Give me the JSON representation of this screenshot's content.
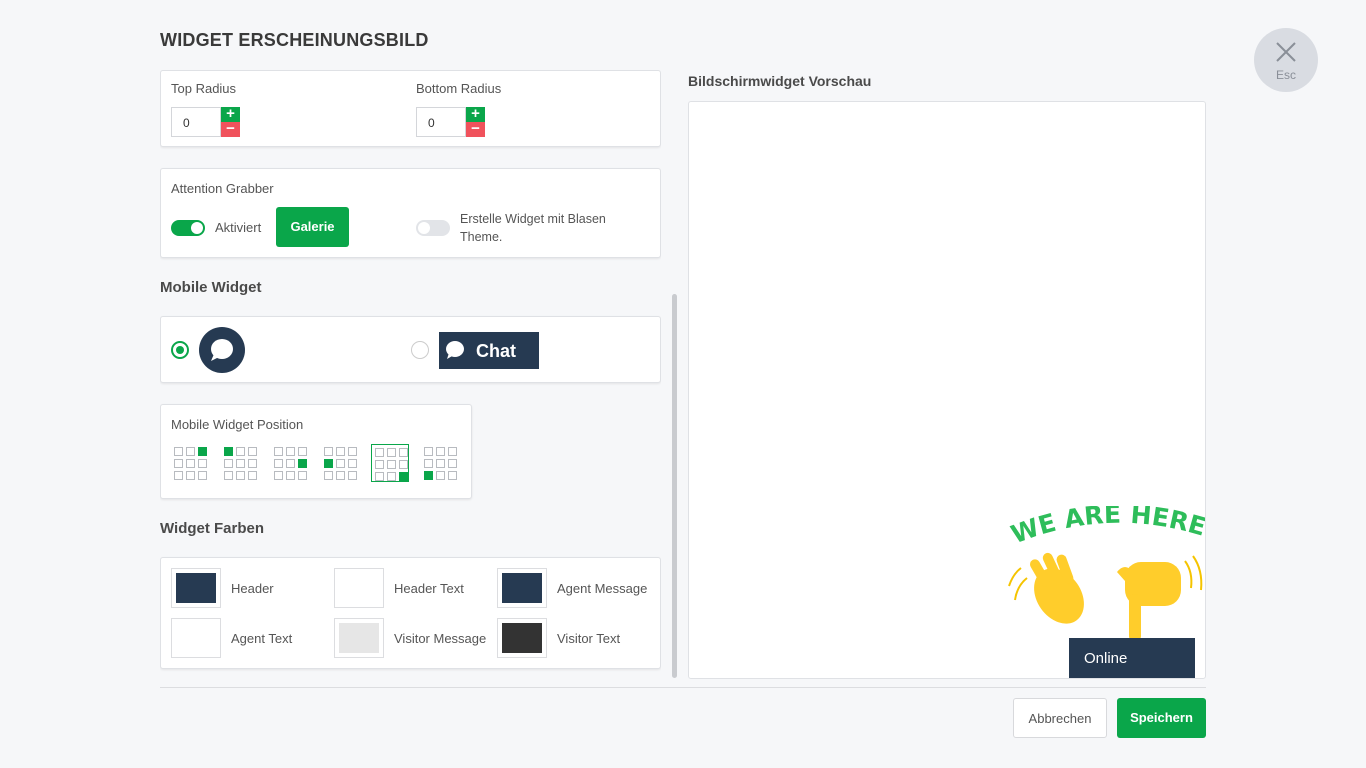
{
  "page": {
    "title": "WIDGET ERSCHEINUNGSBILD"
  },
  "close": {
    "label": "Esc"
  },
  "radius": {
    "top_label": "Top Radius",
    "top_value": "0",
    "bottom_label": "Bottom Radius",
    "bottom_value": "0",
    "plus": "+",
    "minus": "−"
  },
  "attention": {
    "title": "Attention Grabber",
    "toggle_label": "Aktiviert",
    "gallery_button": "Galerie",
    "bubble_label": "Erstelle Widget mit Blasen Theme."
  },
  "mobile_widget": {
    "title": "Mobile Widget",
    "chat_label": "Chat"
  },
  "mobile_position": {
    "title": "Mobile Widget Position",
    "selected_index": 4
  },
  "colors": {
    "title": "Widget Farben",
    "items": [
      {
        "label": "Header",
        "color": "#263a52"
      },
      {
        "label": "Header Text",
        "color": "#ffffff"
      },
      {
        "label": "Agent Message",
        "color": "#263a52"
      },
      {
        "label": "Agent Text",
        "color": "#ffffff"
      },
      {
        "label": "Visitor Message",
        "color": "#e6e6e6"
      },
      {
        "label": "Visitor Text",
        "color": "#333333"
      }
    ]
  },
  "preview": {
    "title": "Bildschirmwidget Vorschau",
    "banner_text": "WE ARE HERE!",
    "status": "Online"
  },
  "footer": {
    "cancel": "Abbrechen",
    "save": "Speichern"
  },
  "theme": {
    "accent": "#0aa64a",
    "danger": "#f0525c",
    "navy": "#263a52"
  }
}
